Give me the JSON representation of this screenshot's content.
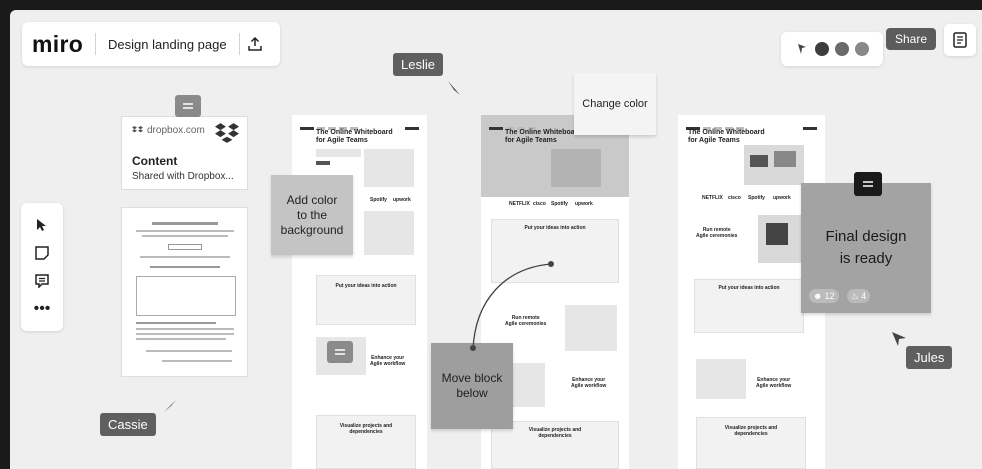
{
  "app": {
    "logo": "miro",
    "board_name": "Design landing page"
  },
  "header": {
    "share_label": "Share"
  },
  "toolbar": {
    "tools": [
      "select-tool",
      "sticky-note-tool",
      "comment-tool",
      "more-tools"
    ],
    "more_label": "•••"
  },
  "dropbox_card": {
    "source": "dropbox.com",
    "title": "Content",
    "subtitle": "Shared with Dropbox..."
  },
  "stickies": {
    "add_color": "Add color\nto the\nbackground",
    "change_color": "Change color",
    "move_block": "Move block\nbelow",
    "final_design": "Final design\nis ready"
  },
  "reactions": {
    "thumbs_count": "12",
    "fire_count": "4"
  },
  "cursors": {
    "leslie": "Leslie",
    "cassie": "Cassie",
    "jules": "Jules"
  },
  "frames": {
    "hero_title": "The Online Whiteboard\nfor Agile Teams",
    "put_ideas": "Put your ideas into action",
    "run_remote": "Run remote\nAgile ceremonies",
    "enhance": "Enhance your\nAgile workflow",
    "visualize": "Visualize projects and\ndependencies",
    "logos": [
      "NETFLIX",
      "cisco",
      "Spotify",
      "upwork"
    ]
  },
  "colors": {
    "canvas": "#efefef",
    "sticky_light": "#c8c8c8",
    "sticky_dark": "#9a9a9a",
    "tag": "#5f5f5f"
  }
}
